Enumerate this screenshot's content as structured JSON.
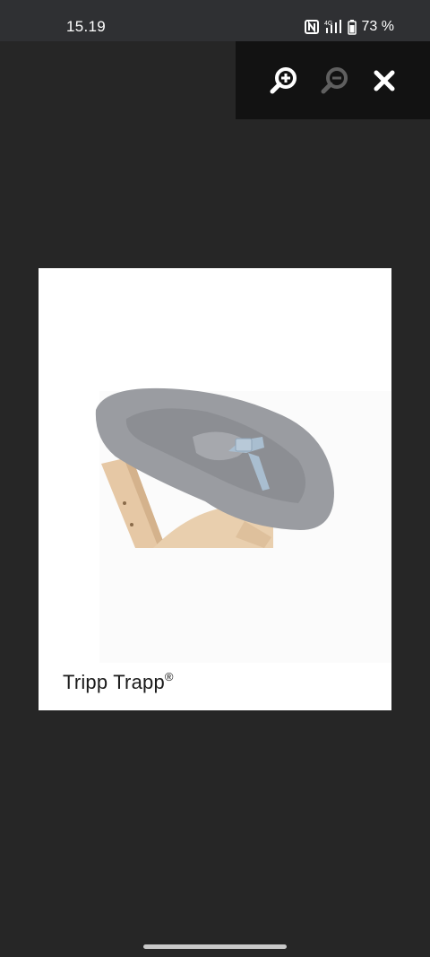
{
  "status_bar": {
    "time": "15.19",
    "network": "4G",
    "battery": "73 %"
  },
  "toolbar": {
    "zoom_in_icon": "zoom-in-icon",
    "zoom_out_icon": "zoom-out-icon",
    "close_icon": "close-icon"
  },
  "image": {
    "subject": "grey newborn seat cushion on wooden high chair",
    "caption": "Tripp Trapp",
    "caption_mark": "®"
  },
  "colors": {
    "background": "#262626",
    "status_bar": "#2f3033",
    "toolbar": "#121212",
    "seat_grey": "#9a9ca1",
    "wood": "#e3c6a3"
  }
}
